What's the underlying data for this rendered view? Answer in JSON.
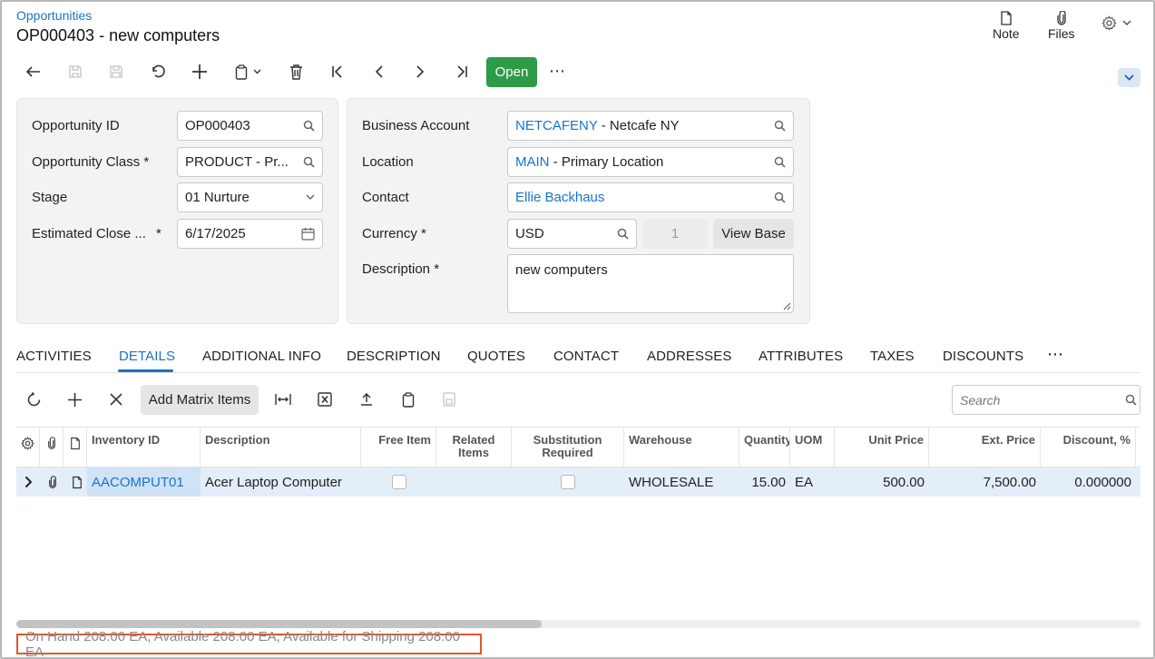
{
  "header": {
    "breadcrumb": "Opportunities",
    "title": "OP000403 - new computers",
    "note_label": "Note",
    "files_label": "Files"
  },
  "toolbar": {
    "open_label": "Open",
    "more_label": "⋯"
  },
  "summary_left": {
    "opportunity_id_label": "Opportunity ID",
    "opportunity_id_value": "OP000403",
    "opportunity_class_label": "Opportunity Class *",
    "opportunity_class_value": "PRODUCT - Pr...",
    "stage_label": "Stage",
    "stage_value": "01 Nurture",
    "est_close_label": "Estimated Close ...",
    "est_close_required": "*",
    "est_close_value": "6/17/2025"
  },
  "summary_right": {
    "business_account_label": "Business Account",
    "business_account_code": "NETCAFENY",
    "business_account_name": " - Netcafe NY",
    "location_label": "Location",
    "location_code": "MAIN",
    "location_name": " - Primary Location",
    "contact_label": "Contact",
    "contact_value": "Ellie Backhaus",
    "currency_label": "Currency *",
    "currency_value": "USD",
    "currency_rate": "1",
    "view_base_label": "View Base",
    "description_label": "Description *",
    "description_value": "new computers"
  },
  "tabs": {
    "activities": "ACTIVITIES",
    "details": "DETAILS",
    "additional_info": "ADDITIONAL INFO",
    "description": "DESCRIPTION",
    "quotes": "QUOTES",
    "contact": "CONTACT",
    "addresses": "ADDRESSES",
    "attributes": "ATTRIBUTES",
    "taxes": "TAXES",
    "discounts": "DISCOUNTS",
    "more": "⋯",
    "active": "DETAILS"
  },
  "grid_toolbar": {
    "add_matrix_items_label": "Add Matrix Items",
    "search_placeholder": "Search"
  },
  "grid": {
    "columns": {
      "inventory_id": "Inventory ID",
      "description": "Description",
      "free_item": "Free Item",
      "related_items_1": "Related",
      "related_items_2": "Items",
      "substitution_1": "Substitution",
      "substitution_2": "Required",
      "warehouse": "Warehouse",
      "quantity": "Quantity",
      "uom": "UOM",
      "unit_price": "Unit Price",
      "ext_price": "Ext. Price",
      "discount_pct": "Discount, %"
    },
    "rows": [
      {
        "inventory_id": "AACOMPUT01",
        "description": "Acer Laptop Computer",
        "free_item": false,
        "substitution_required": false,
        "warehouse": "WHOLESALE",
        "quantity": "15.00",
        "uom": "EA",
        "unit_price": "500.00",
        "ext_price": "7,500.00",
        "discount_pct": "0.000000"
      }
    ]
  },
  "status_bar": {
    "text": "On Hand 208.00 EA, Available 208.00 EA, Available for Shipping 208.00 EA"
  },
  "colors": {
    "link": "#1a73c8",
    "primary_button": "#2e9b47",
    "selected_row": "#e3eef9",
    "status_border": "#e2572b"
  }
}
